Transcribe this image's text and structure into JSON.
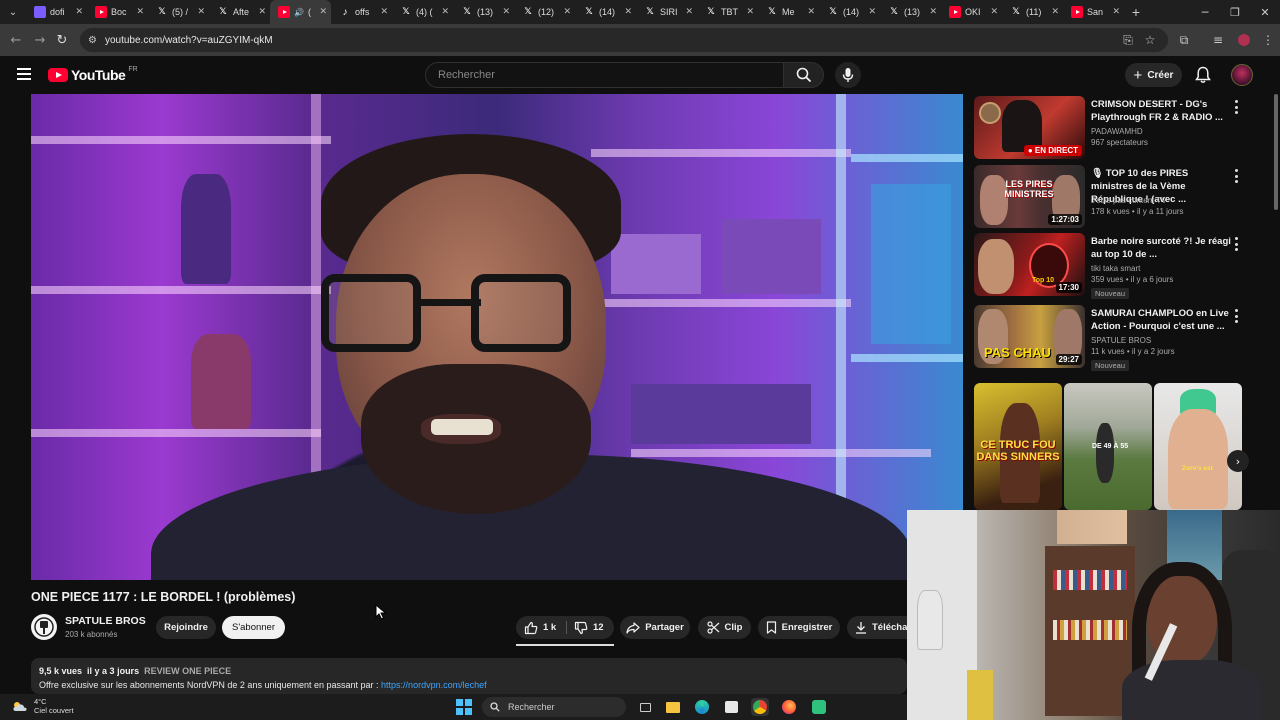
{
  "browser": {
    "tabs": [
      {
        "title": "dofi",
        "icon": "doc-icon"
      },
      {
        "title": "Boc",
        "icon": "youtube-icon"
      },
      {
        "title": "(5) /",
        "icon": "x-icon"
      },
      {
        "title": "Afte",
        "icon": "x-icon"
      },
      {
        "title": "(",
        "icon": "youtube-icon",
        "active": true
      },
      {
        "title": "offs",
        "icon": "tiktok-icon"
      },
      {
        "title": "(4) (",
        "icon": "x-icon"
      },
      {
        "title": "(13)",
        "icon": "x-icon"
      },
      {
        "title": "(12)",
        "icon": "x-icon"
      },
      {
        "title": "(14)",
        "icon": "x-icon"
      },
      {
        "title": "SIRI",
        "icon": "x-icon"
      },
      {
        "title": "TBT",
        "icon": "x-icon"
      },
      {
        "title": "Me",
        "icon": "x-icon"
      },
      {
        "title": "(14)",
        "icon": "x-icon"
      },
      {
        "title": "(13)",
        "icon": "x-icon"
      },
      {
        "title": "OKI",
        "icon": "youtube-icon"
      },
      {
        "title": "(11)",
        "icon": "x-icon"
      },
      {
        "title": "San",
        "icon": "youtube-icon"
      }
    ],
    "url": "youtube.com/watch?v=auZGYIM-qkM"
  },
  "header": {
    "logo_text": "YouTube",
    "country": "FR",
    "search_placeholder": "Rechercher",
    "create_label": "Créer"
  },
  "video": {
    "title": "ONE PIECE 1177 : LE BORDEL ! (problèmes)",
    "channel": "SPATULE BROS",
    "subscribers": "203 k abonnés",
    "join_label": "Rejoindre",
    "subscribe_label": "S'abonner",
    "likes": "1 k",
    "dislikes": "12",
    "share_label": "Partager",
    "clip_label": "Clip",
    "save_label": "Enregistrer",
    "download_label": "Télécha",
    "views": "9,5 k vues",
    "age": "il y a 3 jours",
    "tag": "REVIEW ONE PIECE",
    "description": "Offre exclusive sur les abonnements NordVPN de 2 ans uniquement en passant par :",
    "description_link": "https://nordvpn.com/lechef"
  },
  "recommendations": [
    {
      "title": "CRIMSON DESERT - DG's Playthrough FR 2 & RADIO ...",
      "channel": "PADAWAMHD",
      "meta": "967 spectateurs",
      "live": "EN DIRECT",
      "thumb_text": ""
    },
    {
      "title": "🎙 TOP 10 des PIRES ministres de la Vème République ! (avec ...",
      "channel": "J'suis pas content TV",
      "meta": "178 k vues • il y a 11 jours",
      "duration": "1:27:03",
      "thumb_text": "LES PIRES MINISTRES"
    },
    {
      "title": "Barbe noire surcoté ?! Je réagi au top 10 de ...",
      "channel": "tiki taka smart",
      "meta": "359 vues • il y a 6 jours",
      "duration": "17:30",
      "badge": "Nouveau",
      "thumb_text": "Top 10"
    },
    {
      "title": "SAMURAI CHAMPLOO en Live Action - Pourquoi c'est une ...",
      "channel": "SPATULE BROS",
      "meta": "11 k vues • il y a 2 jours",
      "duration": "29:27",
      "badge": "Nouveau",
      "thumb_text": "PAS CHAU"
    }
  ],
  "shorts": [
    {
      "text": "CE TRUC FOU DANS SINNERS"
    },
    {
      "text": "DE 49 À 55"
    },
    {
      "text": "Zoro's est"
    }
  ],
  "taskbar": {
    "temperature": "4°C",
    "weather": "Ciel couvert",
    "search_label": "Rechercher"
  },
  "colors": {
    "youtube_red": "#ff0033",
    "background": "#0f0f0f",
    "pill": "#272727",
    "link": "#3ea6ff"
  }
}
